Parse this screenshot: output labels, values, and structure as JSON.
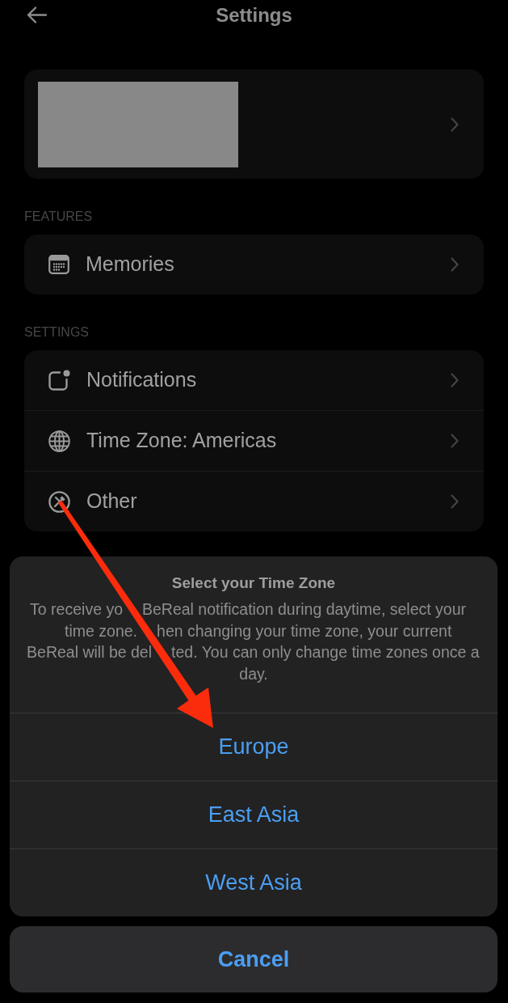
{
  "header": {
    "title": "Settings"
  },
  "sections": [
    {
      "title": "FEATURES",
      "items": [
        {
          "kind": "memories",
          "label": "Memories"
        }
      ]
    },
    {
      "title": "SETTINGS",
      "items": [
        {
          "kind": "notifications",
          "label": "Notifications"
        },
        {
          "kind": "timezone",
          "label": "Time Zone: Americas"
        },
        {
          "kind": "other",
          "label": "Other"
        }
      ]
    }
  ],
  "action_sheet": {
    "title": "Select your Time Zone",
    "message_lines": [
      [
        "To receive yo",
        "BeReal notification during daytime, select your"
      ],
      [
        "time zone.",
        "hen changing your time zone, your current"
      ],
      [
        "BeReal will be del",
        "ted. You can only change time zones once a"
      ],
      [
        "day."
      ]
    ],
    "options": [
      {
        "label": "Europe"
      },
      {
        "label": "East Asia"
      },
      {
        "label": "West Asia"
      }
    ],
    "cancel": "Cancel"
  }
}
